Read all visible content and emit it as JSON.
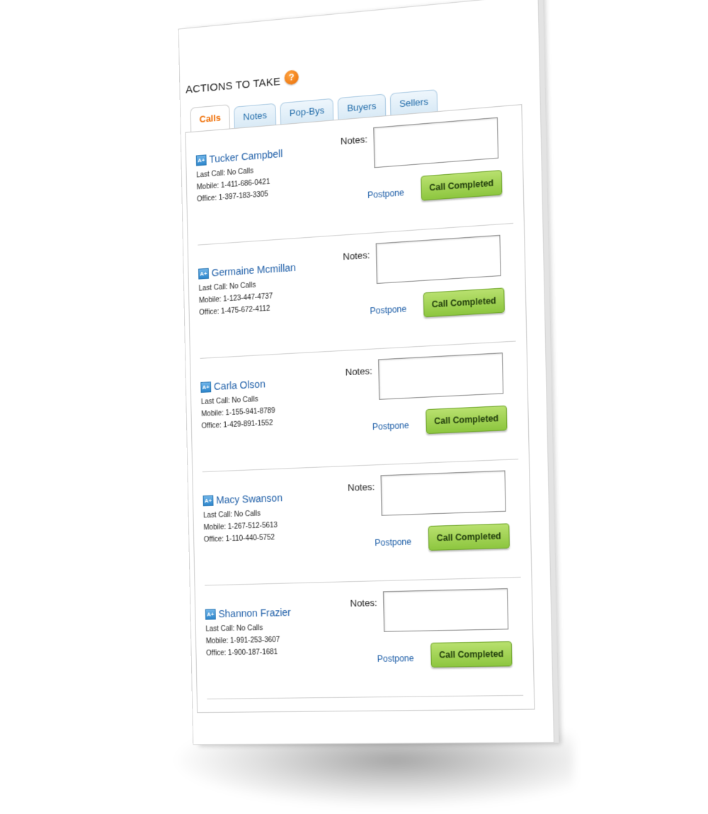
{
  "header": {
    "title": "ACTIONS TO TAKE",
    "help_glyph": "?"
  },
  "tabs": [
    {
      "label": "Calls",
      "active": true
    },
    {
      "label": "Notes",
      "active": false
    },
    {
      "label": "Pop-Bys",
      "active": false
    },
    {
      "label": "Buyers",
      "active": false
    },
    {
      "label": "Sellers",
      "active": false
    }
  ],
  "labels": {
    "notes": "Notes:",
    "postpone": "Postpone",
    "call_completed": "Call Completed",
    "avatar_glyph": "A+"
  },
  "contacts": [
    {
      "name": "Tucker Campbell",
      "last_call": "Last Call: No Calls",
      "mobile": "Mobile: 1-411-686-0421",
      "office": "Office: 1-397-183-3305",
      "notes": ""
    },
    {
      "name": "Germaine Mcmillan",
      "last_call": "Last Call: No Calls",
      "mobile": "Mobile: 1-123-447-4737",
      "office": "Office: 1-475-672-4112",
      "notes": ""
    },
    {
      "name": "Carla Olson",
      "last_call": "Last Call: No Calls",
      "mobile": "Mobile: 1-155-941-8789",
      "office": "Office: 1-429-891-1552",
      "notes": ""
    },
    {
      "name": "Macy Swanson",
      "last_call": "Last Call: No Calls",
      "mobile": "Mobile: 1-267-512-5613",
      "office": "Office: 1-110-440-5752",
      "notes": ""
    },
    {
      "name": "Shannon Frazier",
      "last_call": "Last Call: No Calls",
      "mobile": "Mobile: 1-991-253-3607",
      "office": "Office: 1-900-187-1681",
      "notes": ""
    }
  ],
  "colors": {
    "accent_orange": "#ef6c00",
    "link_blue": "#1f5fa8",
    "button_green": "#8dc63f"
  }
}
